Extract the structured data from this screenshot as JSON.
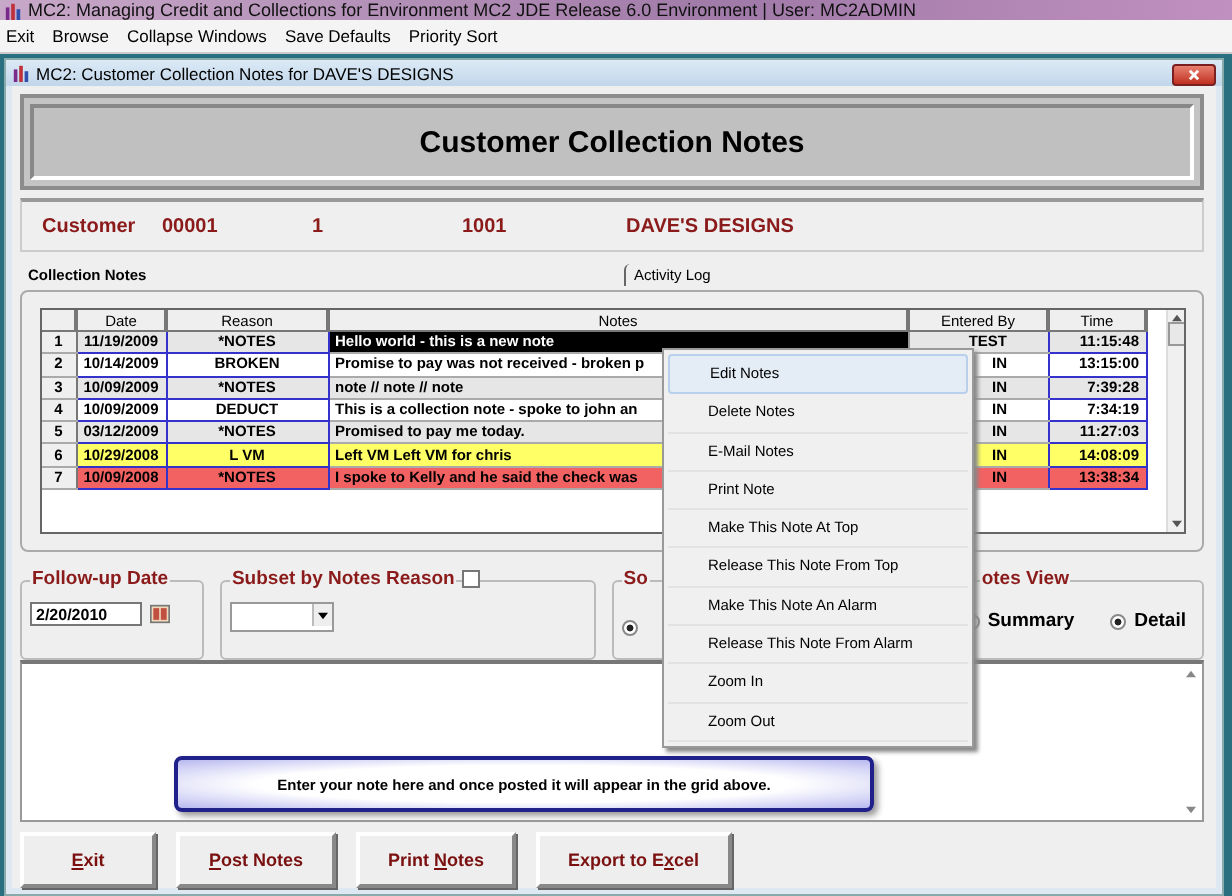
{
  "app_title": "MC2: Managing Credit and Collections for Environment MC2 JDE Release 6.0 Environment  |   User: MC2ADMIN",
  "menu_bar": [
    "Exit",
    "Browse",
    "Collapse Windows",
    "Save Defaults",
    "Priority Sort"
  ],
  "window": {
    "title": "MC2: Customer Collection Notes for DAVE'S DESIGNS"
  },
  "header": "Customer Collection Notes",
  "customer": {
    "label": "Customer",
    "number": "00001",
    "field_2": "1",
    "field_3": "1001",
    "name": "DAVE'S DESIGNS"
  },
  "tabs": [
    {
      "label": "Collection Notes",
      "selected": true
    },
    {
      "label": "Activity Log",
      "selected": false
    }
  ],
  "table": {
    "columns": [
      "Date",
      "Reason",
      "Notes",
      "Entered By",
      "Time"
    ],
    "rows": [
      {
        "number": "1",
        "date": "11/19/2009",
        "reason": "*NOTES",
        "notes": "Hello world - this is a new note",
        "entered_by": "TEST",
        "time": "11:15:48",
        "selected": true
      },
      {
        "number": "2",
        "date": "10/14/2009",
        "reason": "BROKEN",
        "notes": "Promise to pay was not received - broken p",
        "entered_by": "IN",
        "time": "13:15:00",
        "selected": false
      },
      {
        "number": "3",
        "date": "10/09/2009",
        "reason": "*NOTES",
        "notes": "note  //  note  // note",
        "entered_by": "IN",
        "time": "7:39:28",
        "selected": false
      },
      {
        "number": "4",
        "date": "10/09/2009",
        "reason": "DEDUCT",
        "notes": "This is a collection note - spoke to john an",
        "entered_by": "IN",
        "time": "7:34:19",
        "selected": false
      },
      {
        "number": "5",
        "date": "03/12/2009",
        "reason": "*NOTES",
        "notes": "Promised to pay me today.",
        "entered_by": "IN",
        "time": "11:27:03",
        "selected": false
      },
      {
        "number": "6",
        "date": "10/29/2008",
        "reason": "L VM",
        "notes": "Left VM  Left VM  for chris",
        "entered_by": "IN",
        "time": "14:08:09",
        "selected": false,
        "color": "#ffff66"
      },
      {
        "number": "7",
        "date": "10/09/2008",
        "reason": "*NOTES",
        "notes": "I spoke to Kelly and he said the check was",
        "entered_by": "IN",
        "time": "13:38:34",
        "selected": false,
        "color": "#f26262"
      }
    ]
  },
  "follow_up": {
    "title": "Follow-up Date",
    "value": "2/20/2010"
  },
  "subset": {
    "title": "Subset by Notes Reason",
    "checked": false
  },
  "sort": {
    "title": "So",
    "radio_checked": true
  },
  "notes_view": {
    "title": "otes View",
    "options": [
      {
        "label": "Summary",
        "selected": false
      },
      {
        "label": "Detail",
        "selected": true
      }
    ]
  },
  "note_hint": "Enter your note here and once posted it will appear in the grid above.",
  "context_menu": [
    {
      "label": "Edit Notes",
      "selected": true
    },
    {
      "label": "Delete Notes",
      "selected": false
    },
    {
      "label": "E-Mail Notes",
      "selected": false
    },
    {
      "label": "Print Note",
      "selected": false
    },
    {
      "label": "Make This Note At Top",
      "selected": false
    },
    {
      "label": "Release This Note From Top",
      "selected": false
    },
    {
      "label": "Make This Note An Alarm",
      "selected": false
    },
    {
      "label": "Release This Note From Alarm",
      "selected": false
    },
    {
      "label": "Zoom In",
      "selected": false
    },
    {
      "label": "Zoom Out",
      "selected": false
    }
  ],
  "buttons": [
    {
      "key": "E",
      "after": "xit"
    },
    {
      "key": "P",
      "after": "ost Notes"
    },
    {
      "before": "Print ",
      "key": "N",
      "after": "otes"
    },
    {
      "before": "Export to E",
      "key": "x",
      "after": "cel"
    }
  ]
}
